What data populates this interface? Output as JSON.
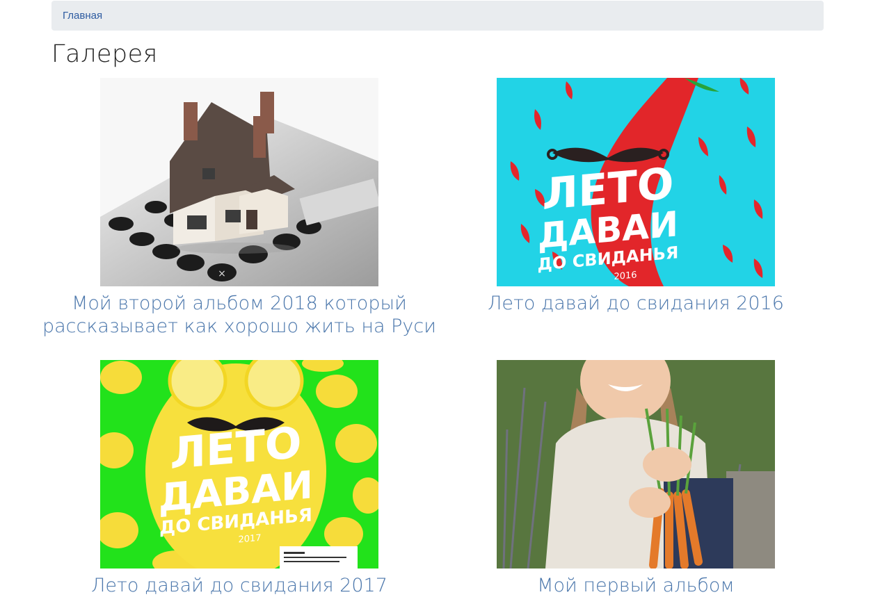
{
  "breadcrumb": {
    "home_label": "Главная"
  },
  "page": {
    "title": "Галерея"
  },
  "albums": [
    {
      "title": "Мой второй альбом 2018 который рассказывает как хорошо жить на Руси",
      "image": "house-on-calculator"
    },
    {
      "title": "Лето давай до свидания 2016",
      "image": "summer-pepper-poster"
    },
    {
      "title": "Лето давай до свидания 2017",
      "image": "summer-lemon-poster"
    },
    {
      "title": "Мой первый альбом",
      "image": "girl-with-carrots"
    }
  ],
  "posters": {
    "pepper": {
      "line1": "ЛЕТО",
      "line2": "ДАВАИ",
      "line3": "ДО СВИДАНЬЯ",
      "year": "2016"
    },
    "lemon": {
      "line1": "ЛЕТО",
      "line2": "ДАВАИ",
      "line3": "ДО СВИДАНЬЯ",
      "year": "2017"
    }
  },
  "colors": {
    "link": "#4a76ab",
    "breadcrumb_bg": "#e9ecef",
    "pepper_bg": "#22d3e6",
    "lemon_bg": "#22e21b"
  }
}
